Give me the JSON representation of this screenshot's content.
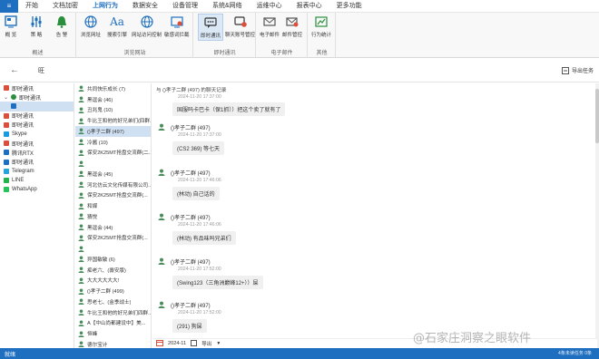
{
  "menu": {
    "app_icon": "≡",
    "items": [
      "开始",
      "文档加密",
      "上网行为",
      "数据安全",
      "设备管理",
      "系统&网络",
      "运维中心",
      "报表中心",
      "更多功能"
    ]
  },
  "ribbon": {
    "groups": [
      {
        "title": "概述",
        "buttons": [
          "概 览",
          "策 略",
          "告 警"
        ]
      },
      {
        "title": "浏览网站",
        "buttons": [
          "浏览网址",
          "搜索引擎",
          "网站访问控制",
          "敏感词拦截"
        ]
      },
      {
        "title": "即时通讯",
        "buttons": [
          "即时通讯",
          "聊天账号管控"
        ]
      },
      {
        "title": "电子邮件",
        "buttons": [
          "电子邮件",
          "邮件管控"
        ]
      },
      {
        "title": "其他",
        "buttons": [
          "行为统计"
        ]
      }
    ]
  },
  "toolbar": {
    "crumb": "旺",
    "export_label": "导出任务"
  },
  "sidebar": {
    "items": [
      {
        "label": "即时通讯",
        "color": "#d94f3b"
      },
      {
        "label": "即时通讯",
        "color": "#2a8f3c"
      },
      {
        "label": "",
        "color": "#1e6fc0"
      },
      {
        "label": "即时通讯",
        "color": "#d94f3b"
      },
      {
        "label": "即时通讯",
        "color": "#d94f3b"
      },
      {
        "label": "Skype",
        "color": "#1b9ae0"
      },
      {
        "label": "即时通讯",
        "color": "#d94f3b"
      },
      {
        "label": "腾讯RTX",
        "color": "#1e6fc0"
      },
      {
        "label": "即时通讯",
        "color": "#1e6fc0"
      },
      {
        "label": "Telegram",
        "color": "#2aa3dd"
      },
      {
        "label": "LINE",
        "color": "#22b34a"
      },
      {
        "label": "WhatsApp",
        "color": "#25c45a"
      }
    ]
  },
  "contacts": [
    "共同快乐成长 (7)",
    "黑逗会 (46)",
    "丑兆鬼 (10)",
    "牛比王和他的好兄弟们(四群...",
    "()孝子二群 (497)",
    "冷酱 (10)",
    "保安2K25MT抢盘交流群(二...",
    "",
    "黑逗会 (45)",
    "河北仿云文化传媒有限公司...",
    "保安2K25MT抢盘交流群(...",
    "和媒",
    "猜悦",
    "黑逗会 (44)",
    "保安2K25MT抢盘交流群(...",
    "",
    "异国敏敏 (6)",
    "痴老六、(壽安版)",
    "大大大大大大!",
    "()孝子二群 (499)",
    "思老七、(金季战士)",
    "牛比王和他的好兄弟们四群...",
    "A【中山尚都建设中】美...",
    "恒峰",
    "德尔宝计"
  ],
  "chat": {
    "header": "与 ()孝子二群 (497) 的聊天记录",
    "messages": [
      {
        "who": "",
        "time": "2024-11-20 17:37:00",
        "text": "国服吗卡巴卡（保1抓））把这个卖了就有了"
      },
      {
        "who": "()孝子二群 (497)",
        "time": "2024-11-20 17:37:00",
        "text": "(CS2 369) 等七天"
      },
      {
        "who": "()孝子二群 (497)",
        "time": "2024-11-20 17:46:06",
        "text": "(林动) 自己话的"
      },
      {
        "who": "()孝子二群 (497)",
        "time": "2024-11-20 17:46:06",
        "text": "(林动) 有品味吗兄弟们"
      },
      {
        "who": "()孝子二群 (497)",
        "time": "2024-11-20 17:52:00",
        "text": "(Swing123（三角洲巅峰12+））屎"
      },
      {
        "who": "()孝子二群 (497)",
        "time": "2024-11-20 17:52:00",
        "text": "(291) 狗屎"
      }
    ],
    "footer_date": "2024-11",
    "footer_export": "导出"
  },
  "watermark": "@石家庄洞察之眼软件",
  "status": {
    "left": "就绪",
    "right": "4条未读任务 0条"
  },
  "colors": {
    "accent": "#1e6fc0"
  }
}
